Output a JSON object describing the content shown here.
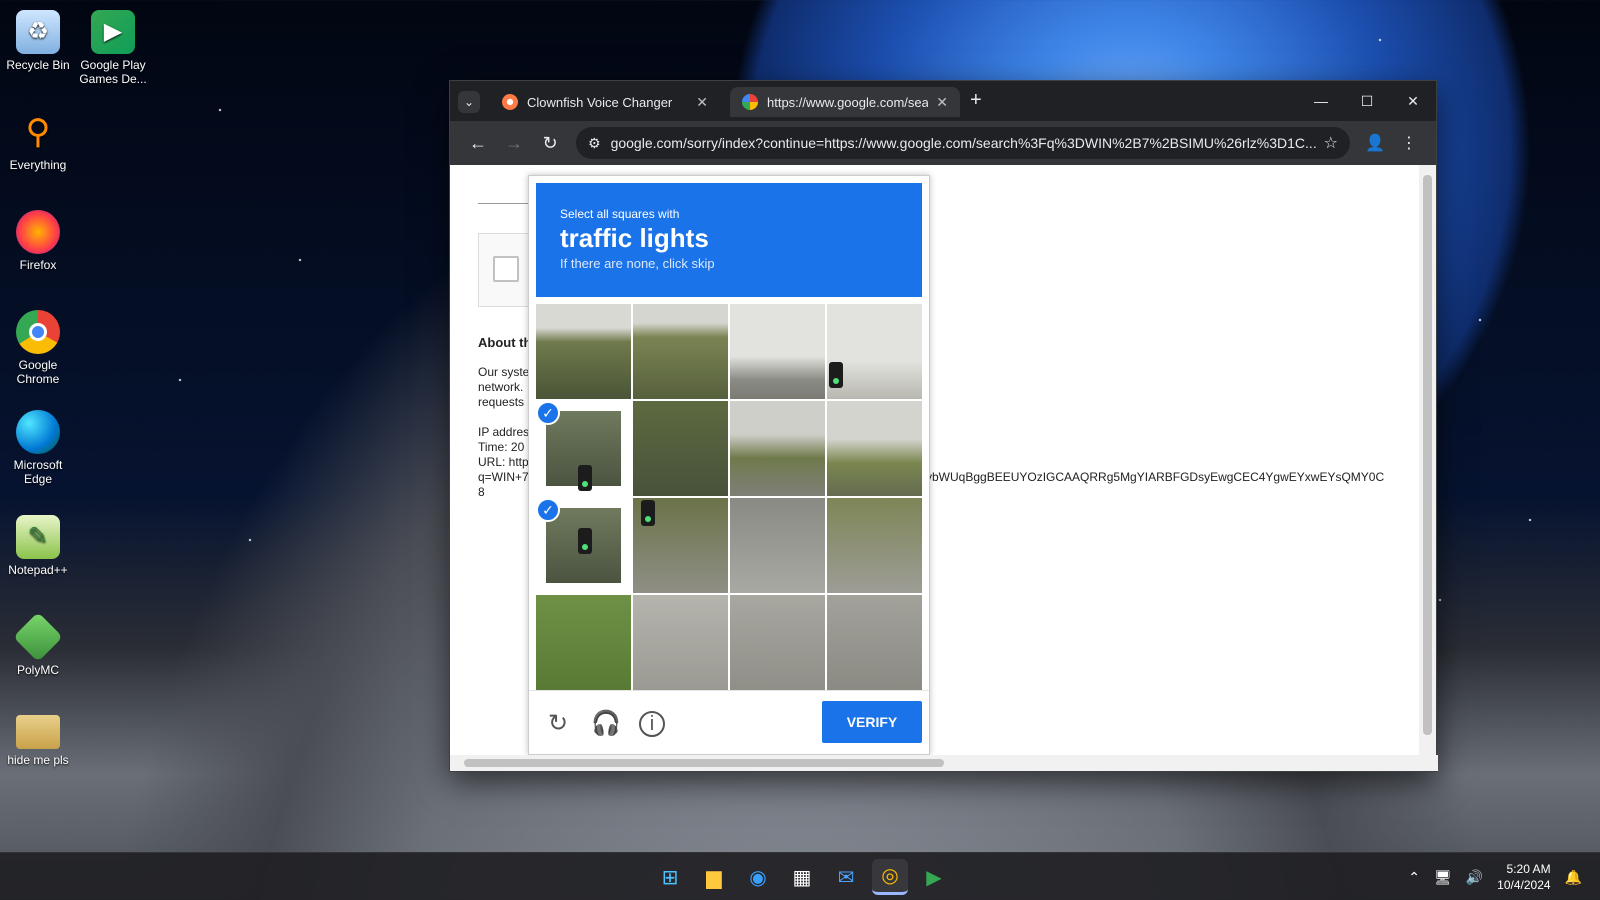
{
  "desktop": {
    "icons": [
      {
        "label": "Recycle Bin",
        "icon": "recycle-bin-icon"
      },
      {
        "label": "Google Play Games De...",
        "icon": "google-play-games-icon"
      },
      {
        "label": "Everything",
        "icon": "everything-search-icon"
      },
      {
        "label": "Firefox",
        "icon": "firefox-icon"
      },
      {
        "label": "Google Chrome",
        "icon": "chrome-icon"
      },
      {
        "label": "Microsoft Edge",
        "icon": "edge-icon"
      },
      {
        "label": "Notepad++",
        "icon": "notepadpp-icon"
      },
      {
        "label": "PolyMC",
        "icon": "polymc-icon"
      },
      {
        "label": "hide me pls",
        "icon": "folder-icon"
      }
    ]
  },
  "browser": {
    "tabs": [
      {
        "label": "Clownfish Voice Changer",
        "active": false
      },
      {
        "label": "https://www.google.com/search",
        "active": true
      }
    ],
    "address": "google.com/sorry/index?continue=https://www.google.com/search%3Fq%3DWIN%2B7%2BSIMU%26rlz%3D1C...",
    "colors": {
      "frame": "#202124",
      "toolbar": "#35363a",
      "accent": "#1a73e8"
    }
  },
  "page": {
    "about_heading": "About th",
    "para_lines": [
      "Our syste",
      "network.",
      "requests"
    ],
    "info_lines": [
      "IP addres",
      "Time: 20",
      "URL: http",
      "q=WIN+7",
      "8"
    ],
    "long_line": "vbWUqBggBEEUYOzIGCAAQRRg5MgYIARBFGDsyEwgCEC4YgwEYxwEYsQMY0C"
  },
  "captcha": {
    "instruction": "Select all squares with",
    "target": "traffic lights",
    "hint": "If there are none, click skip",
    "verify_label": "VERIFY",
    "selected_tiles": [
      4,
      8
    ]
  },
  "taskbar": {
    "time": "5:20 AM",
    "date": "10/4/2024"
  }
}
